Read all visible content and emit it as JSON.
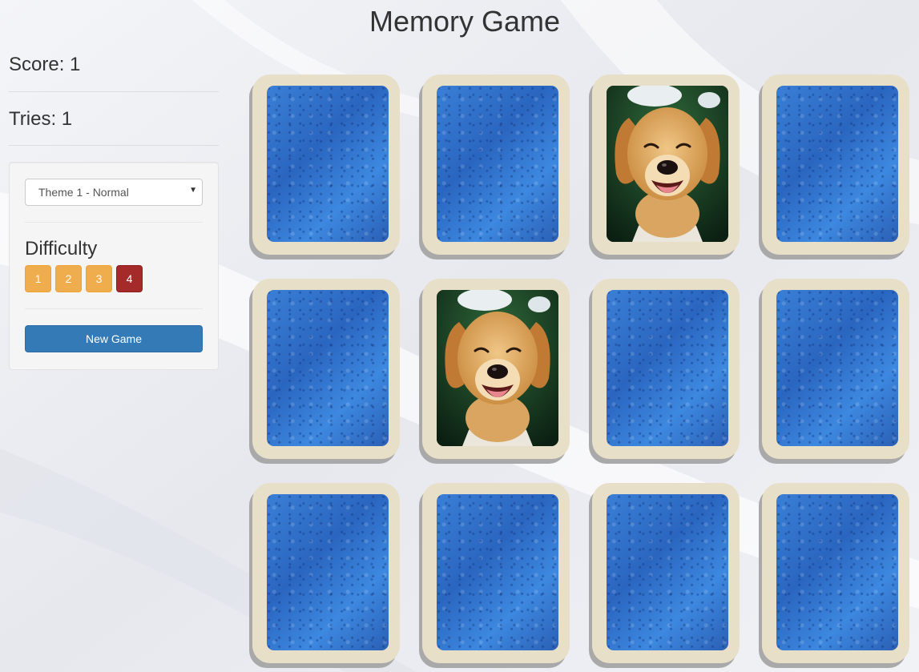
{
  "header": {
    "title": "Memory Game"
  },
  "stats": {
    "score": "Score: 1",
    "tries": "Tries: 1"
  },
  "controls": {
    "theme_selected": "Theme 1 - Normal",
    "difficulty_label": "Difficulty",
    "difficulty_options": [
      "1",
      "2",
      "3",
      "4"
    ],
    "difficulty_active": "4",
    "new_game_label": "New Game"
  },
  "board": {
    "rows": 3,
    "cols": 4,
    "cards": [
      {
        "state": "face-down"
      },
      {
        "state": "face-down"
      },
      {
        "state": "face-up",
        "image": "puppy"
      },
      {
        "state": "face-down"
      },
      {
        "state": "face-down"
      },
      {
        "state": "face-up",
        "image": "puppy"
      },
      {
        "state": "face-down"
      },
      {
        "state": "face-down"
      },
      {
        "state": "face-down"
      },
      {
        "state": "face-down"
      },
      {
        "state": "face-down"
      },
      {
        "state": "face-down"
      }
    ]
  },
  "colors": {
    "card_back": "#2f73cc",
    "card_border": "#e8dfc8",
    "difficulty_button": "#f0ad4e",
    "difficulty_active": "#a52a2a",
    "primary_button": "#337ab7"
  }
}
